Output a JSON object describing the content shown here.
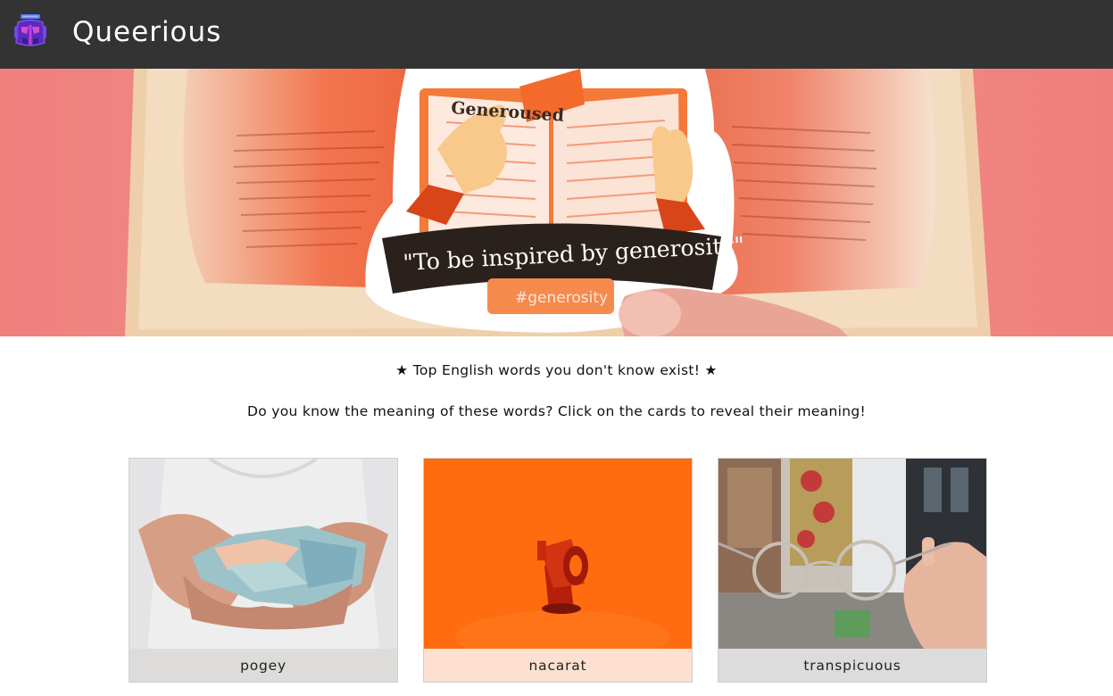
{
  "app": {
    "brand": "Queerious",
    "logo_icon": "robot-icon",
    "accent": "#7b3fe4",
    "nav_background": "#333333"
  },
  "hero": {
    "sticker_title": "Generoused",
    "sticker_quote": "\"To be inspired by generosity\"",
    "sticker_tag": "#generosity"
  },
  "main": {
    "heading": "★ Top English words you don't know exist! ★",
    "subheading": "Do you know the meaning of these words? Click on the cards to reveal their meaning!"
  },
  "cards": [
    {
      "word": "pogey",
      "image_icon": "money-hands-image",
      "caption_bg": "#dedcda"
    },
    {
      "word": "nacarat",
      "image_icon": "megaphone-image",
      "caption_bg": "#fde0cf"
    },
    {
      "word": "transpicuous",
      "image_icon": "eyeglasses-image",
      "caption_bg": "#dcdcdc"
    }
  ]
}
